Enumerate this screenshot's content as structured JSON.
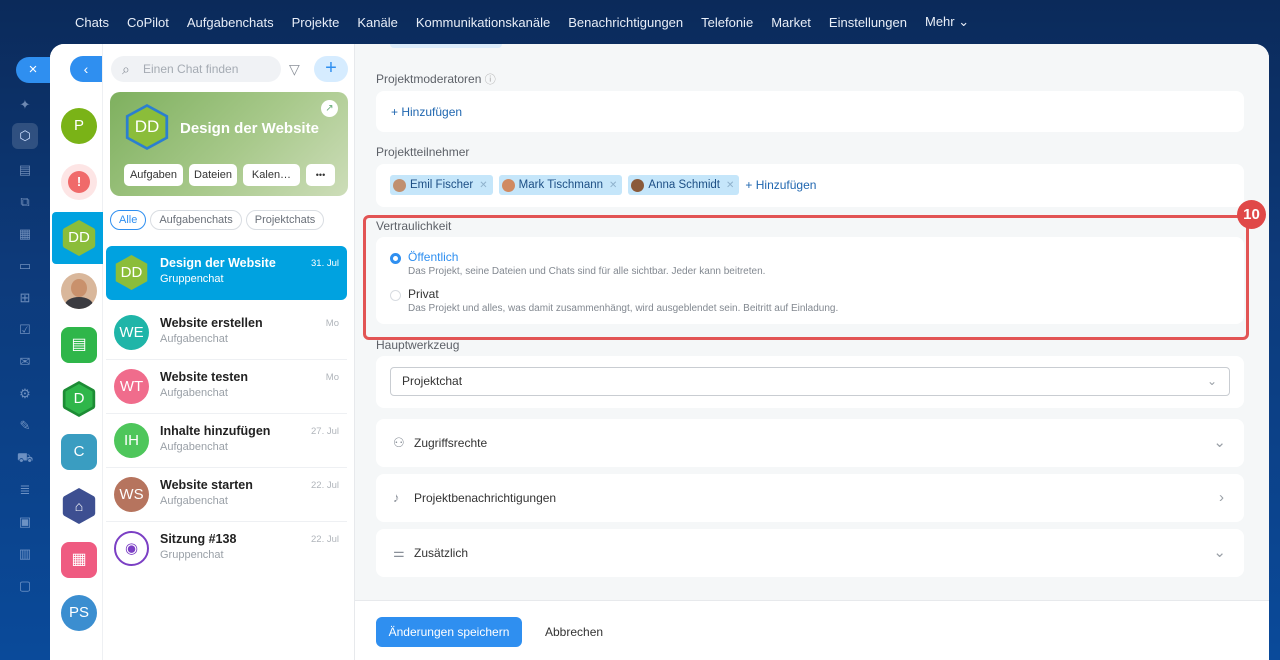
{
  "topnav": {
    "items": [
      "Chats",
      "CoPilot",
      "Aufgabenchats",
      "Projekte",
      "Kanäle",
      "Kommunikationskanäle",
      "Benachrichtigungen",
      "Telefonie",
      "Market",
      "Einstellungen",
      "Mehr ⌄"
    ]
  },
  "close_icon": "×",
  "back_icon": "‹",
  "avatars": [
    {
      "text": "P",
      "color": "#7ab317"
    },
    {
      "text": "!",
      "color": "#f0a0a0"
    },
    {
      "text": "DD",
      "color": "#8bbd3a"
    },
    {
      "text": "",
      "color": "#b58a68"
    },
    {
      "text": "",
      "color": "#2fb64a"
    },
    {
      "text": "D",
      "color": "#2fb64a"
    },
    {
      "text": "C",
      "color": "#3a9dc1"
    },
    {
      "text": "",
      "color": "#3d4f91"
    },
    {
      "text": "",
      "color": "#ef5b81"
    },
    {
      "text": "PS",
      "color": "#3b8ed0"
    }
  ],
  "search": {
    "placeholder": "Einen Chat finden"
  },
  "card": {
    "avatar": "DD",
    "title": "Design der Website",
    "buttons": [
      "Aufgaben",
      "Dateien",
      "Kalen…",
      "•••"
    ]
  },
  "tabs": [
    "Alle",
    "Aufgabenchats",
    "Projektchats"
  ],
  "chats": [
    {
      "initials": "DD",
      "name": "Design der Website",
      "sub": "Gruppenchat",
      "date": "31. Jul",
      "color": "#8bbd3a"
    },
    {
      "initials": "WE",
      "name": "Website erstellen",
      "sub": "Aufgabenchat",
      "date": "Mo",
      "color": "#1fb5a8"
    },
    {
      "initials": "WT",
      "name": "Website testen",
      "sub": "Aufgabenchat",
      "date": "Mo",
      "color": "#f06c8c"
    },
    {
      "initials": "IH",
      "name": "Inhalte hinzufügen",
      "sub": "Aufgabenchat",
      "date": "27. Jul",
      "color": "#4ec65b"
    },
    {
      "initials": "WS",
      "name": "Website starten",
      "sub": "Aufgabenchat",
      "date": "22. Jul",
      "color": "#b6745e"
    },
    {
      "initials": "",
      "name": "Sitzung #138",
      "sub": "Gruppenchat",
      "date": "22. Jul",
      "color": "#7b3fc4"
    }
  ],
  "main": {
    "moderators_label": "Projektmoderatoren",
    "add_link": "+ Hinzufügen",
    "participants_label": "Projektteilnehmer",
    "participants": [
      "Emil Fischer",
      "Mark Tischmann",
      "Anna Schmidt"
    ],
    "add_link2": "+ Hinzufügen",
    "privacy_label": "Vertraulichkeit",
    "public_title": "Öffentlich",
    "public_desc": "Das Projekt, seine Dateien und Chats sind für alle sichtbar. Jeder kann beitreten.",
    "private_title": "Privat",
    "private_desc": "Das Projekt und alles, was damit zusammenhängt, wird ausgeblendet sein. Beitritt auf Einladung.",
    "tool_label": "Hauptwerkzeug",
    "tool_value": "Projektchat",
    "access": "Zugriffsrechte",
    "notif": "Projektbenachrichtigungen",
    "extra": "Zusätzlich"
  },
  "badge": "10",
  "footer": {
    "save": "Änderungen speichern",
    "cancel": "Abbrechen"
  },
  "colors": {
    "accent": "#2f8ff0",
    "highlight": "#e25454",
    "selected_chat": "#00a2e0"
  }
}
